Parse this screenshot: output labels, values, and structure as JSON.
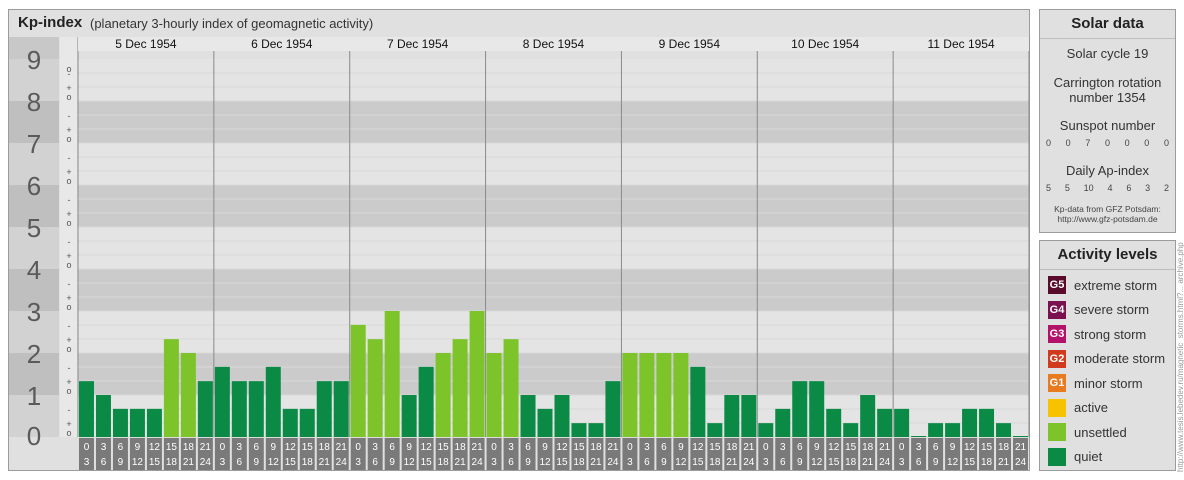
{
  "header": {
    "title": "Kp-index",
    "subtitle": "(planetary 3-hourly index of geomagnetic activity)"
  },
  "solar": {
    "title": "Solar data",
    "cycle": "Solar cycle 19",
    "carrington_line1": "Carrington rotation",
    "carrington_line2": "number 1354",
    "sunspot_label": "Sunspot number",
    "sunspot_values": [
      "0",
      "0",
      "7",
      "0",
      "0",
      "0",
      "0"
    ],
    "ap_label": "Daily Ap-index",
    "ap_values": [
      "5",
      "5",
      "10",
      "4",
      "6",
      "3",
      "2"
    ],
    "source_line1": "Kp-data from GFZ Potsdam:",
    "source_line2": "http://www.gfz-potsdam.de"
  },
  "levels": {
    "title": "Activity levels",
    "items": [
      {
        "code": "G5",
        "label": "extreme storm",
        "color": "#5a0a2a"
      },
      {
        "code": "G4",
        "label": "severe storm",
        "color": "#7a1050"
      },
      {
        "code": "G3",
        "label": "strong storm",
        "color": "#b3126b"
      },
      {
        "code": "G2",
        "label": "moderate storm",
        "color": "#d23a1e"
      },
      {
        "code": "G1",
        "label": "minor storm",
        "color": "#e87a20"
      },
      {
        "code": "",
        "label": "active",
        "color": "#f7c300"
      },
      {
        "code": "",
        "label": "unsettled",
        "color": "#7dc42a"
      },
      {
        "code": "",
        "label": "quiet",
        "color": "#0a8a45"
      }
    ]
  },
  "watermark": "http://www.tesis.lebedev.ru/magnetic_storms.html?... archive.php",
  "chart_data": {
    "type": "bar",
    "title": "Kp-index",
    "ylim": [
      0,
      9
    ],
    "y_ticks": [
      "0",
      "1",
      "2",
      "3",
      "4",
      "5",
      "6",
      "7",
      "8",
      "9"
    ],
    "sub_ticks": [
      "+",
      "o",
      "-"
    ],
    "days": [
      "5 Dec 1954",
      "6 Dec 1954",
      "7 Dec 1954",
      "8 Dec 1954",
      "9 Dec 1954",
      "10 Dec 1954",
      "11 Dec 1954"
    ],
    "hour_start": [
      "0",
      "3",
      "6",
      "9",
      "12",
      "15",
      "18",
      "21"
    ],
    "hour_end": [
      "3",
      "6",
      "9",
      "12",
      "15",
      "18",
      "21",
      "24"
    ],
    "series": [
      {
        "values": [
          1.33,
          1.0,
          0.67,
          0.67,
          0.67,
          2.33,
          2.0,
          1.33,
          1.67,
          1.33,
          1.33,
          1.67,
          0.67,
          0.67,
          1.33,
          1.33,
          2.67,
          2.33,
          3.0,
          1.0,
          1.67,
          2.0,
          2.33,
          3.0,
          2.0,
          2.33,
          1.0,
          0.67,
          1.0,
          0.33,
          0.33,
          1.33,
          2.0,
          2.0,
          2.0,
          2.0,
          1.67,
          0.33,
          1.0,
          1.0,
          0.33,
          0.67,
          1.33,
          1.33,
          0.67,
          0.33,
          1.0,
          0.67,
          0.67,
          0.0,
          0.33,
          0.33,
          0.67,
          0.67,
          0.33,
          0.0
        ]
      }
    ],
    "colors": {
      "quiet": "#0a8a45",
      "unsettled": "#7dc42a",
      "active": "#f7c300"
    }
  }
}
